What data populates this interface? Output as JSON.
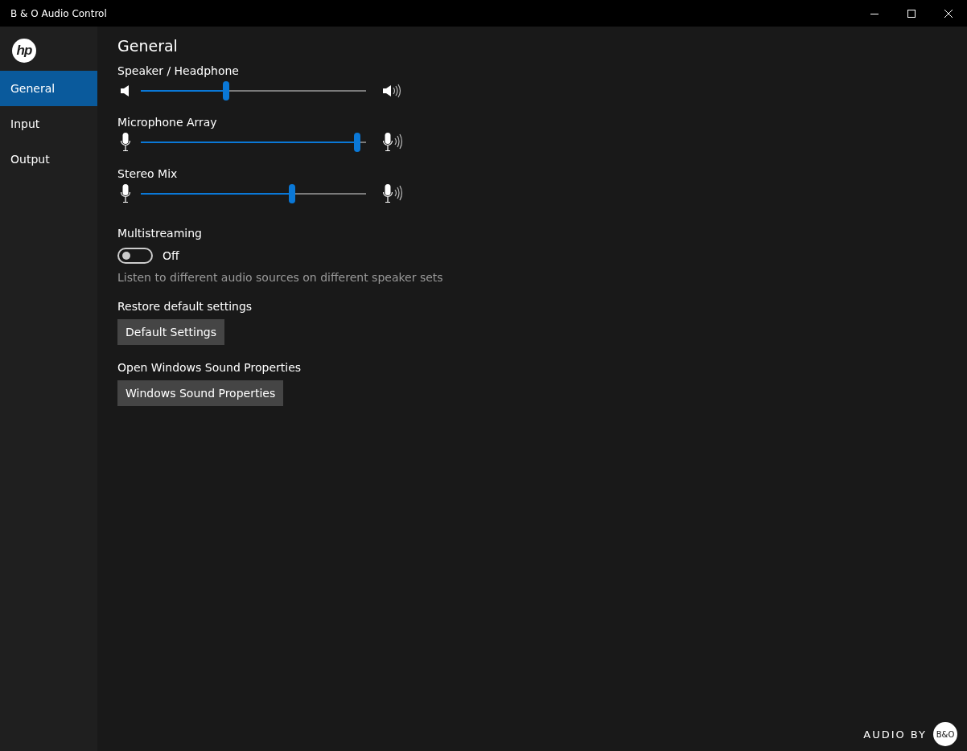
{
  "window": {
    "title": "B & O Audio Control"
  },
  "sidebar": {
    "logo": "hp",
    "items": [
      {
        "label": "General",
        "selected": true
      },
      {
        "label": "Input",
        "selected": false
      },
      {
        "label": "Output",
        "selected": false
      }
    ]
  },
  "page_title": "General",
  "sliders": [
    {
      "label": "Speaker / Headphone",
      "kind": "speaker",
      "level": 0.38
    },
    {
      "label": "Microphone Array",
      "kind": "microphone",
      "level": 0.96
    },
    {
      "label": "Stereo Mix",
      "kind": "microphone",
      "level": 0.67
    }
  ],
  "multistreaming": {
    "label": "Multistreaming",
    "on": false,
    "state_text": "Off",
    "description": "Listen to different audio sources on different speaker sets"
  },
  "actions": [
    {
      "label": "Restore default settings",
      "button": "Default Settings"
    },
    {
      "label": "Open Windows Sound Properties",
      "button": "Windows Sound Properties"
    }
  ],
  "footer": {
    "text": "AUDIO BY",
    "brand": "B&O"
  }
}
